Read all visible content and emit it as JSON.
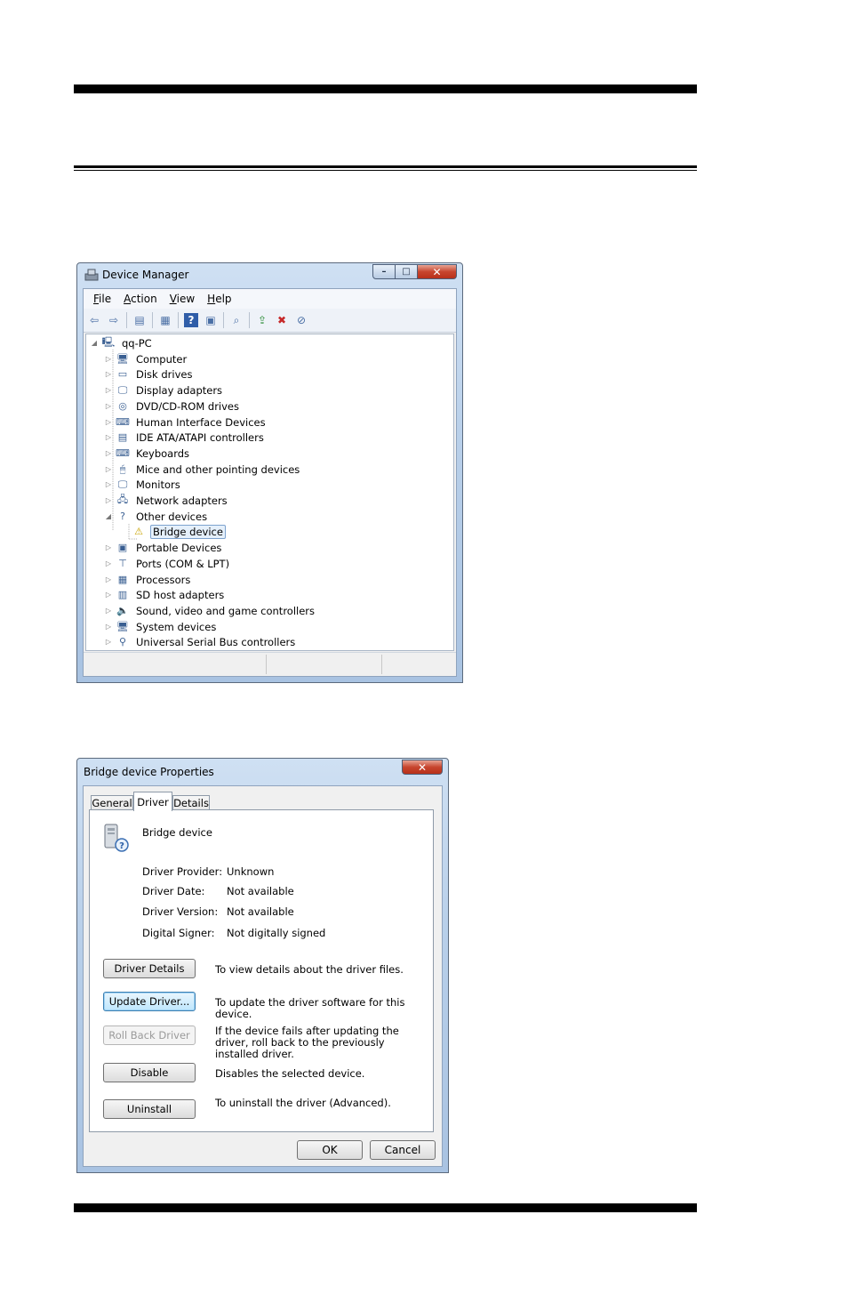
{
  "device_manager": {
    "title": "Device Manager",
    "window_buttons": {
      "minimize": "–",
      "maximize": "□",
      "close": "✕"
    },
    "menu": [
      {
        "label": "File",
        "key": "F",
        "rest": "ile"
      },
      {
        "label": "Action",
        "key": "A",
        "rest": "ction"
      },
      {
        "label": "View",
        "key": "V",
        "rest": "iew"
      },
      {
        "label": "Help",
        "key": "H",
        "rest": "elp"
      }
    ],
    "tree": {
      "root": "qq-PC",
      "items": [
        {
          "label": "Computer",
          "icon": "computer-icon",
          "glyph": "🖥"
        },
        {
          "label": "Disk drives",
          "icon": "disk-drive-icon",
          "glyph": "▭"
        },
        {
          "label": "Display adapters",
          "icon": "display-adapter-icon",
          "glyph": "🖵"
        },
        {
          "label": "DVD/CD-ROM drives",
          "icon": "dvd-drive-icon",
          "glyph": "◎"
        },
        {
          "label": "Human Interface Devices",
          "icon": "hid-icon",
          "glyph": "⌨"
        },
        {
          "label": "IDE ATA/ATAPI controllers",
          "icon": "ide-controller-icon",
          "glyph": "▤"
        },
        {
          "label": "Keyboards",
          "icon": "keyboard-icon",
          "glyph": "⌨"
        },
        {
          "label": "Mice and other pointing devices",
          "icon": "mouse-icon",
          "glyph": "🖱"
        },
        {
          "label": "Monitors",
          "icon": "monitor-icon",
          "glyph": "🖵"
        },
        {
          "label": "Network adapters",
          "icon": "network-adapter-icon",
          "glyph": "🖧"
        },
        {
          "label": "Other devices",
          "icon": "other-devices-icon",
          "glyph": "?"
        },
        {
          "label": "Bridge device",
          "icon": "warning-device-icon",
          "glyph": "⚠"
        },
        {
          "label": "Portable Devices",
          "icon": "portable-device-icon",
          "glyph": "▣"
        },
        {
          "label": "Ports (COM & LPT)",
          "icon": "port-icon",
          "glyph": "⊤"
        },
        {
          "label": "Processors",
          "icon": "processor-icon",
          "glyph": "▦"
        },
        {
          "label": "SD host adapters",
          "icon": "sd-adapter-icon",
          "glyph": "▥"
        },
        {
          "label": "Sound, video and game controllers",
          "icon": "speaker-icon",
          "glyph": "🔈"
        },
        {
          "label": "System devices",
          "icon": "system-device-icon",
          "glyph": "🖥"
        },
        {
          "label": "Universal Serial Bus controllers",
          "icon": "usb-icon",
          "glyph": "⚲"
        }
      ]
    }
  },
  "properties": {
    "title": "Bridge device Properties",
    "close": "✕",
    "tabs": [
      "General",
      "Driver",
      "Details"
    ],
    "active_tab": "Driver",
    "device_name": "Bridge device",
    "fields": [
      {
        "label": "Driver Provider:",
        "value": "Unknown"
      },
      {
        "label": "Driver Date:",
        "value": "Not available"
      },
      {
        "label": "Driver Version:",
        "value": "Not available"
      },
      {
        "label": "Digital Signer:",
        "value": "Not digitally signed"
      }
    ],
    "buttons": [
      {
        "label": "Driver Details",
        "desc": "To view details about the driver files."
      },
      {
        "label": "Update Driver...",
        "desc": "To update the driver software for this device."
      },
      {
        "label": "Roll Back Driver",
        "desc": "If the device fails after updating the driver, roll back to the previously installed driver."
      },
      {
        "label": "Disable",
        "desc": "Disables the selected device."
      },
      {
        "label": "Uninstall",
        "desc": "To uninstall the driver (Advanced)."
      }
    ],
    "ok": "OK",
    "cancel": "Cancel"
  }
}
